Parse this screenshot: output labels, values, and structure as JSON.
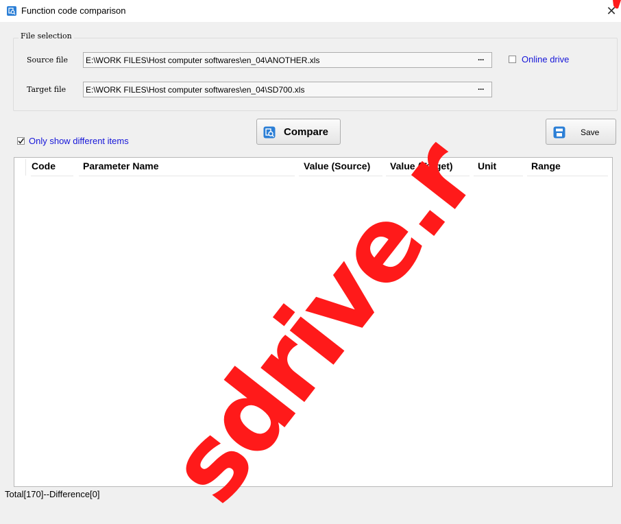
{
  "window": {
    "title": "Function code comparison",
    "close_icon": "close-icon",
    "title_icon": "compare-app-icon"
  },
  "file_selection": {
    "legend": "File selection",
    "source_label": "Source file",
    "source_value": "E:\\WORK FILES\\Host computer softwares\\en_04\\ANOTHER.xls",
    "target_label": "Target file",
    "target_value": "E:\\WORK FILES\\Host computer softwares\\en_04\\SD700.xls",
    "browse_label": "···",
    "online_drive_label": "Online drive",
    "online_drive_checked": false
  },
  "options": {
    "only_diff_label": "Only show different items",
    "only_diff_checked": true
  },
  "buttons": {
    "compare_label": "Compare",
    "save_label": "Save"
  },
  "table": {
    "columns": [
      "Code",
      "Parameter Name",
      "Value (Source)",
      "Value (Target)",
      "Unit",
      "Range"
    ],
    "rows": []
  },
  "status": {
    "text": "Total[170]--Difference[0]"
  },
  "watermark": {
    "text": "sdrive.r"
  },
  "colors": {
    "accent_blue": "#1515d8",
    "icon_blue": "#2c7fd6",
    "watermark_red": "#ff1a1a"
  }
}
